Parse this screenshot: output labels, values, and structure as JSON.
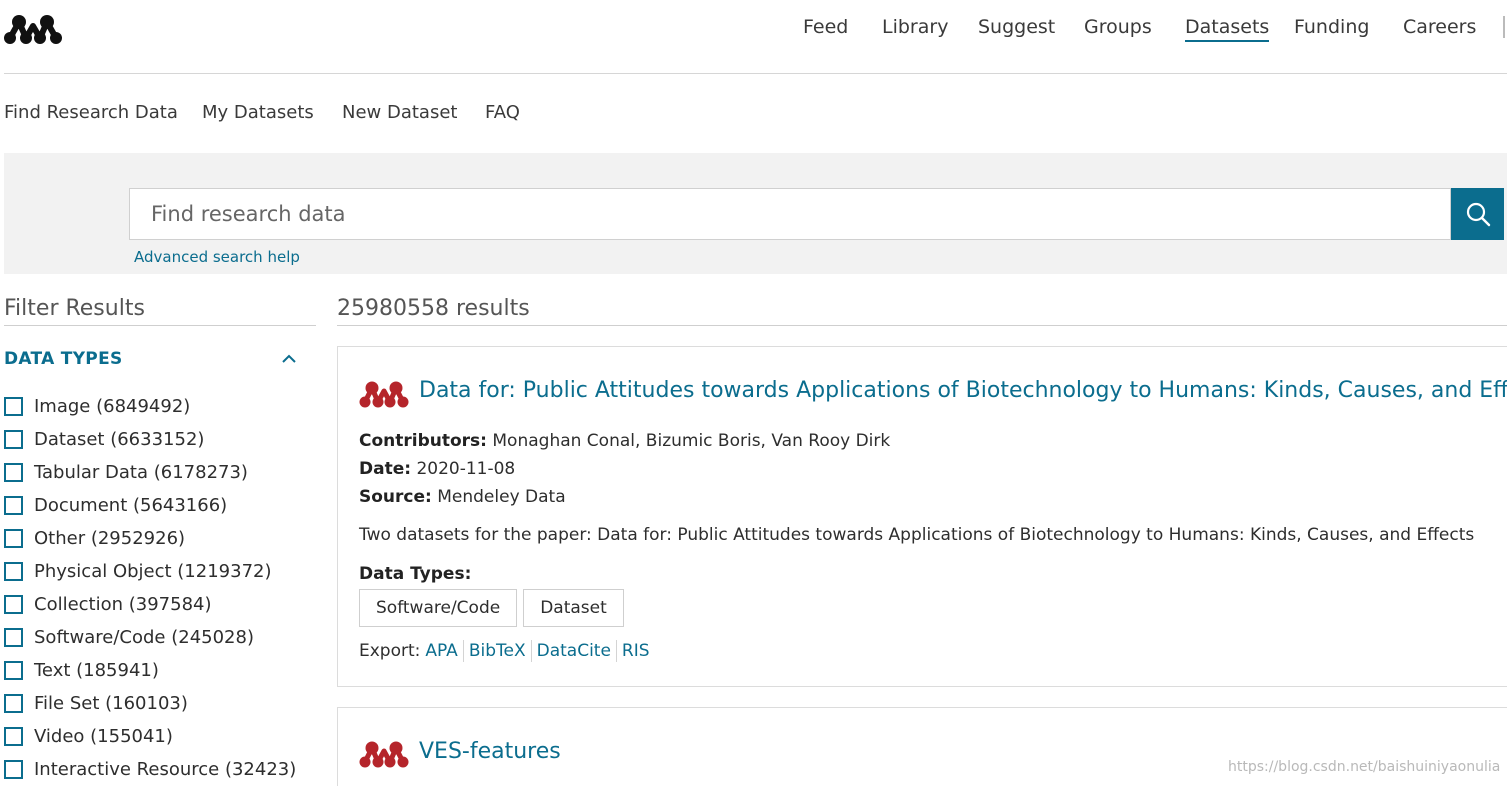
{
  "header": {
    "nav": [
      {
        "label": "Feed"
      },
      {
        "label": "Library"
      },
      {
        "label": "Suggest"
      },
      {
        "label": "Groups"
      },
      {
        "label": "Datasets",
        "active": true
      },
      {
        "label": "Funding"
      },
      {
        "label": "Careers"
      }
    ]
  },
  "subnav": [
    {
      "label": "Find Research Data"
    },
    {
      "label": "My Datasets"
    },
    {
      "label": "New Dataset"
    },
    {
      "label": "FAQ"
    }
  ],
  "search": {
    "placeholder": "Find research data",
    "value": "",
    "advanced_help": "Advanced search help"
  },
  "filters": {
    "title": "Filter Results",
    "data_types_heading": "DATA TYPES",
    "items": [
      {
        "label": "Image (6849492)"
      },
      {
        "label": "Dataset (6633152)"
      },
      {
        "label": "Tabular Data (6178273)"
      },
      {
        "label": "Document (5643166)"
      },
      {
        "label": "Other (2952926)"
      },
      {
        "label": "Physical Object (1219372)"
      },
      {
        "label": "Collection (397584)"
      },
      {
        "label": "Software/Code (245028)"
      },
      {
        "label": "Text (185941)"
      },
      {
        "label": "File Set (160103)"
      },
      {
        "label": "Video (155041)"
      },
      {
        "label": "Interactive Resource (32423)"
      }
    ]
  },
  "results": {
    "count": "25980558 results",
    "items": [
      {
        "title": "Data for: Public Attitudes towards Applications of Biotechnology to Humans: Kinds, Causes, and Effects",
        "contributors_label": "Contributors:",
        "contributors": "Monaghan Conal, Bizumic Boris, Van Rooy Dirk",
        "date_label": "Date:",
        "date": "2020-11-08",
        "source_label": "Source:",
        "source": "Mendeley Data",
        "description": "Two datasets for the paper: Data for: Public Attitudes towards Applications of Biotechnology to Humans: Kinds, Causes, and Effects",
        "data_types_label": "Data Types:",
        "data_types": [
          "Software/Code",
          "Dataset"
        ],
        "export_label": "Export:",
        "export_links": [
          "APA",
          "BibTeX",
          "DataCite",
          "RIS"
        ]
      },
      {
        "title": "VES-features"
      }
    ]
  },
  "watermark": "https://blog.csdn.net/baishuiniyaonulia",
  "colors": {
    "accent": "#0b6d8e",
    "brand_red": "#b5252b",
    "band_bg": "#f2f2f2"
  },
  "icons": {
    "logo": "mendeley-logo-icon",
    "search": "search-icon",
    "collapse": "chevron-up-icon",
    "result": "mendeley-data-icon"
  }
}
